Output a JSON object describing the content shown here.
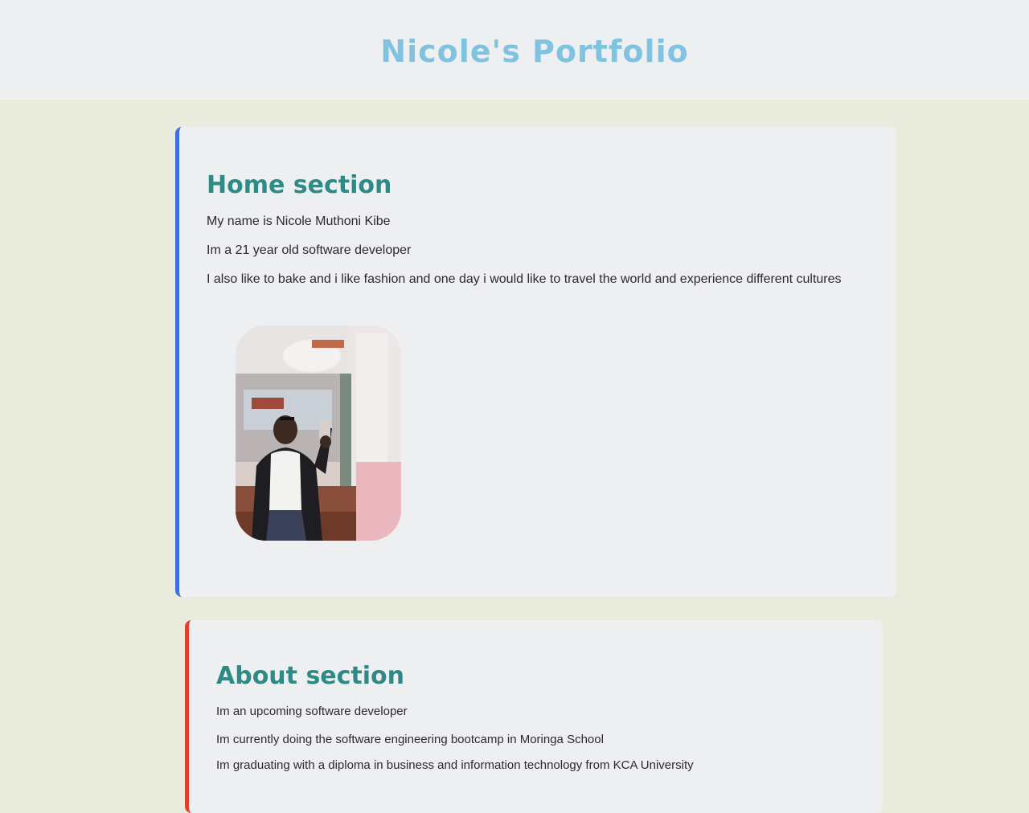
{
  "header": {
    "title": "Nicole's Portfolio"
  },
  "home": {
    "heading": "Home section",
    "paragraphs": [
      "My name is Nicole Muthoni Kibe",
      "Im a 21 year old software developer",
      "I also like to bake and i like fashion and one day i would like to travel the world and experience different cultures"
    ]
  },
  "about": {
    "heading": "About section",
    "paragraphs": [
      "Im an upcoming software developer",
      "Im currently doing the software engineering bootcamp in Moringa School",
      "Im graduating with a diploma in business and information technology from KCA University"
    ]
  },
  "colors": {
    "title": "#7fc3e0",
    "heading": "#2f8a86",
    "home_accent": "#3f6fe0",
    "about_accent": "#e0402e",
    "page_background": "#e9ebdc"
  }
}
